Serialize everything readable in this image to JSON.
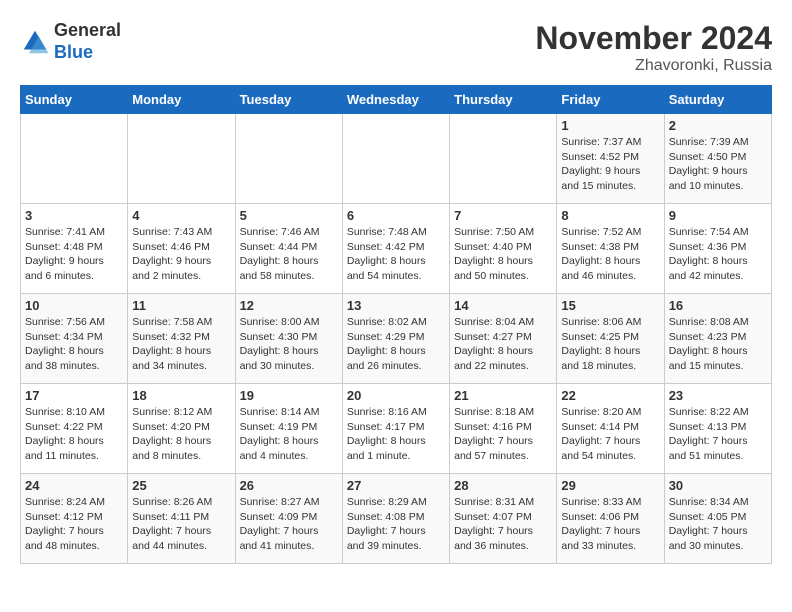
{
  "header": {
    "logo_general": "General",
    "logo_blue": "Blue",
    "month": "November 2024",
    "location": "Zhavoronki, Russia"
  },
  "weekdays": [
    "Sunday",
    "Monday",
    "Tuesday",
    "Wednesday",
    "Thursday",
    "Friday",
    "Saturday"
  ],
  "weeks": [
    [
      {
        "day": "",
        "info": ""
      },
      {
        "day": "",
        "info": ""
      },
      {
        "day": "",
        "info": ""
      },
      {
        "day": "",
        "info": ""
      },
      {
        "day": "",
        "info": ""
      },
      {
        "day": "1",
        "info": "Sunrise: 7:37 AM\nSunset: 4:52 PM\nDaylight: 9 hours and 15 minutes."
      },
      {
        "day": "2",
        "info": "Sunrise: 7:39 AM\nSunset: 4:50 PM\nDaylight: 9 hours and 10 minutes."
      }
    ],
    [
      {
        "day": "3",
        "info": "Sunrise: 7:41 AM\nSunset: 4:48 PM\nDaylight: 9 hours and 6 minutes."
      },
      {
        "day": "4",
        "info": "Sunrise: 7:43 AM\nSunset: 4:46 PM\nDaylight: 9 hours and 2 minutes."
      },
      {
        "day": "5",
        "info": "Sunrise: 7:46 AM\nSunset: 4:44 PM\nDaylight: 8 hours and 58 minutes."
      },
      {
        "day": "6",
        "info": "Sunrise: 7:48 AM\nSunset: 4:42 PM\nDaylight: 8 hours and 54 minutes."
      },
      {
        "day": "7",
        "info": "Sunrise: 7:50 AM\nSunset: 4:40 PM\nDaylight: 8 hours and 50 minutes."
      },
      {
        "day": "8",
        "info": "Sunrise: 7:52 AM\nSunset: 4:38 PM\nDaylight: 8 hours and 46 minutes."
      },
      {
        "day": "9",
        "info": "Sunrise: 7:54 AM\nSunset: 4:36 PM\nDaylight: 8 hours and 42 minutes."
      }
    ],
    [
      {
        "day": "10",
        "info": "Sunrise: 7:56 AM\nSunset: 4:34 PM\nDaylight: 8 hours and 38 minutes."
      },
      {
        "day": "11",
        "info": "Sunrise: 7:58 AM\nSunset: 4:32 PM\nDaylight: 8 hours and 34 minutes."
      },
      {
        "day": "12",
        "info": "Sunrise: 8:00 AM\nSunset: 4:30 PM\nDaylight: 8 hours and 30 minutes."
      },
      {
        "day": "13",
        "info": "Sunrise: 8:02 AM\nSunset: 4:29 PM\nDaylight: 8 hours and 26 minutes."
      },
      {
        "day": "14",
        "info": "Sunrise: 8:04 AM\nSunset: 4:27 PM\nDaylight: 8 hours and 22 minutes."
      },
      {
        "day": "15",
        "info": "Sunrise: 8:06 AM\nSunset: 4:25 PM\nDaylight: 8 hours and 18 minutes."
      },
      {
        "day": "16",
        "info": "Sunrise: 8:08 AM\nSunset: 4:23 PM\nDaylight: 8 hours and 15 minutes."
      }
    ],
    [
      {
        "day": "17",
        "info": "Sunrise: 8:10 AM\nSunset: 4:22 PM\nDaylight: 8 hours and 11 minutes."
      },
      {
        "day": "18",
        "info": "Sunrise: 8:12 AM\nSunset: 4:20 PM\nDaylight: 8 hours and 8 minutes."
      },
      {
        "day": "19",
        "info": "Sunrise: 8:14 AM\nSunset: 4:19 PM\nDaylight: 8 hours and 4 minutes."
      },
      {
        "day": "20",
        "info": "Sunrise: 8:16 AM\nSunset: 4:17 PM\nDaylight: 8 hours and 1 minute."
      },
      {
        "day": "21",
        "info": "Sunrise: 8:18 AM\nSunset: 4:16 PM\nDaylight: 7 hours and 57 minutes."
      },
      {
        "day": "22",
        "info": "Sunrise: 8:20 AM\nSunset: 4:14 PM\nDaylight: 7 hours and 54 minutes."
      },
      {
        "day": "23",
        "info": "Sunrise: 8:22 AM\nSunset: 4:13 PM\nDaylight: 7 hours and 51 minutes."
      }
    ],
    [
      {
        "day": "24",
        "info": "Sunrise: 8:24 AM\nSunset: 4:12 PM\nDaylight: 7 hours and 48 minutes."
      },
      {
        "day": "25",
        "info": "Sunrise: 8:26 AM\nSunset: 4:11 PM\nDaylight: 7 hours and 44 minutes."
      },
      {
        "day": "26",
        "info": "Sunrise: 8:27 AM\nSunset: 4:09 PM\nDaylight: 7 hours and 41 minutes."
      },
      {
        "day": "27",
        "info": "Sunrise: 8:29 AM\nSunset: 4:08 PM\nDaylight: 7 hours and 39 minutes."
      },
      {
        "day": "28",
        "info": "Sunrise: 8:31 AM\nSunset: 4:07 PM\nDaylight: 7 hours and 36 minutes."
      },
      {
        "day": "29",
        "info": "Sunrise: 8:33 AM\nSunset: 4:06 PM\nDaylight: 7 hours and 33 minutes."
      },
      {
        "day": "30",
        "info": "Sunrise: 8:34 AM\nSunset: 4:05 PM\nDaylight: 7 hours and 30 minutes."
      }
    ]
  ]
}
